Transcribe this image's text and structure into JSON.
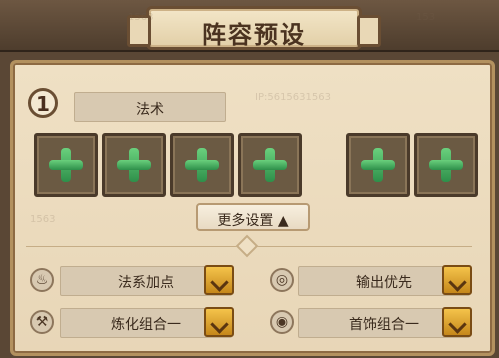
{
  "header": {
    "title": "阵容预设"
  },
  "preset": {
    "number": "1",
    "name": "法术"
  },
  "slots": [
    "",
    "",
    "",
    "",
    "",
    ""
  ],
  "more": {
    "label": "更多设置 ▲"
  },
  "rows": [
    {
      "left_icon": "♨",
      "left_label": "法系加点",
      "right_icon": "◎",
      "right_label": "输出优先"
    },
    {
      "left_icon": "⚒",
      "left_label": "炼化组合一",
      "right_icon": "◉",
      "right_label": "首饰组合一"
    }
  ],
  "watermark": [
    "1563",
    "153",
    "IP:5615631563",
    "1563"
  ]
}
